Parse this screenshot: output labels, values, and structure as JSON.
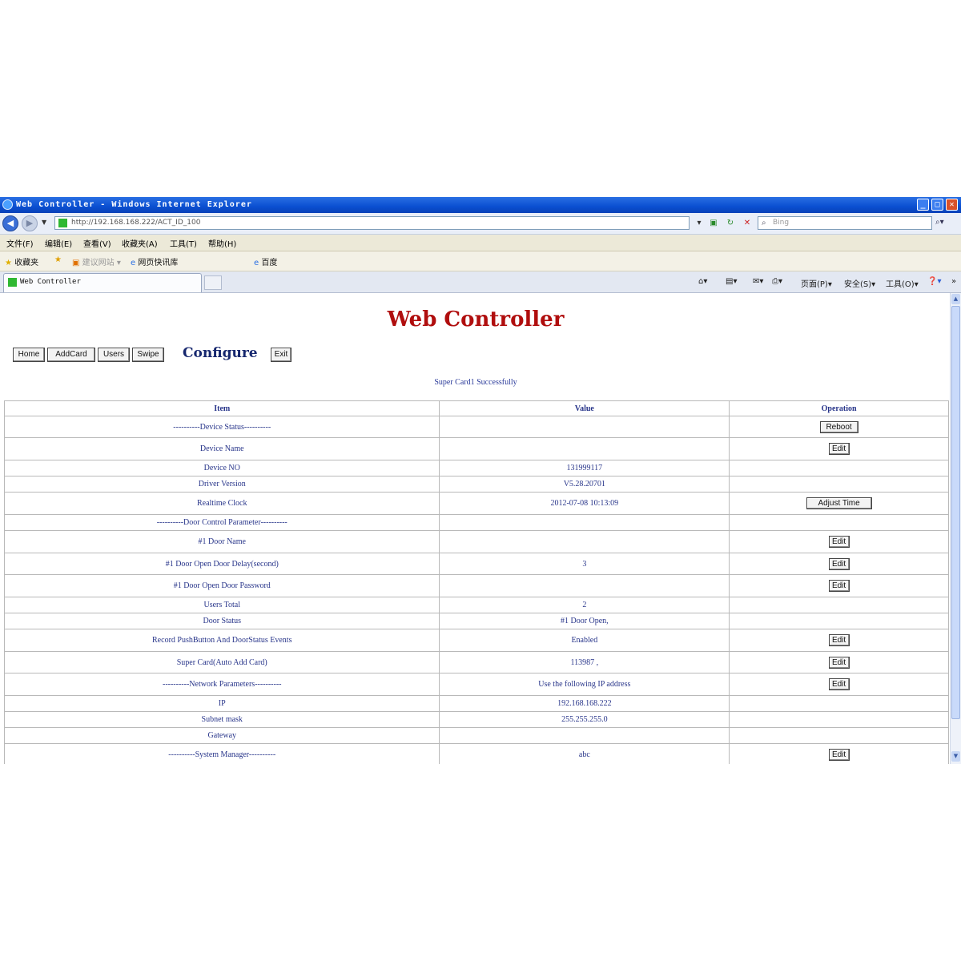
{
  "window": {
    "title": "Web Controller - Windows Internet Explorer"
  },
  "addressbar": {
    "url": "http://192.168.168.222/ACT_ID_100",
    "search_placeholder": "Bing"
  },
  "menubar": {
    "items": [
      "文件(F)",
      "编辑(E)",
      "查看(V)",
      "收藏夹(A)",
      "工具(T)",
      "帮助(H)"
    ]
  },
  "favorites": {
    "items": [
      "收藏夹",
      "建议网站",
      "网页快讯库",
      "百度"
    ]
  },
  "tab": {
    "title": "Web Controller"
  },
  "commandbar": {
    "items": [
      "页面(P)",
      "安全(S)",
      "工具(O)"
    ]
  },
  "page": {
    "title": "Web Controller",
    "nav_buttons": [
      "Home",
      "AddCard",
      "Users",
      "Swipe"
    ],
    "section": "Configure",
    "exit_label": "Exit",
    "status_message": "Super Card1 Successfully"
  },
  "table": {
    "headers": [
      "Item",
      "Value",
      "Operation"
    ],
    "rows": [
      {
        "item": "----------Device Status----------",
        "value": "",
        "op": "Reboot"
      },
      {
        "item": "Device Name",
        "value": "",
        "op": "Edit"
      },
      {
        "item": "Device NO",
        "value": "131999117",
        "op": ""
      },
      {
        "item": "Driver Version",
        "value": "V5.28.20701",
        "op": ""
      },
      {
        "item": "Realtime Clock",
        "value": "2012-07-08 10:13:09",
        "op": "Adjust Time"
      },
      {
        "item": "----------Door Control Parameter----------",
        "value": "",
        "op": ""
      },
      {
        "item": "#1 Door Name",
        "value": "",
        "op": "Edit"
      },
      {
        "item": "#1 Door Open Door Delay(second)",
        "value": "3",
        "op": "Edit"
      },
      {
        "item": "#1 Door Open Door Password",
        "value": "",
        "op": "Edit"
      },
      {
        "item": "Users Total",
        "value": "2",
        "op": ""
      },
      {
        "item": "Door Status",
        "value": "#1 Door Open,",
        "op": ""
      },
      {
        "item": "Record PushButton And DoorStatus Events",
        "value": "Enabled",
        "op": "Edit"
      },
      {
        "item": "Super Card(Auto Add Card)",
        "value": "113987 ,",
        "op": "Edit"
      },
      {
        "item": "----------Network Parameters----------",
        "value": "Use the following IP address",
        "op": "Edit"
      },
      {
        "item": "IP",
        "value": "192.168.168.222",
        "op": ""
      },
      {
        "item": "Subnet mask",
        "value": "255.255.255.0",
        "op": ""
      },
      {
        "item": "Gateway",
        "value": "",
        "op": ""
      },
      {
        "item": "----------System Manager----------",
        "value": "abc",
        "op": "Edit"
      }
    ]
  }
}
